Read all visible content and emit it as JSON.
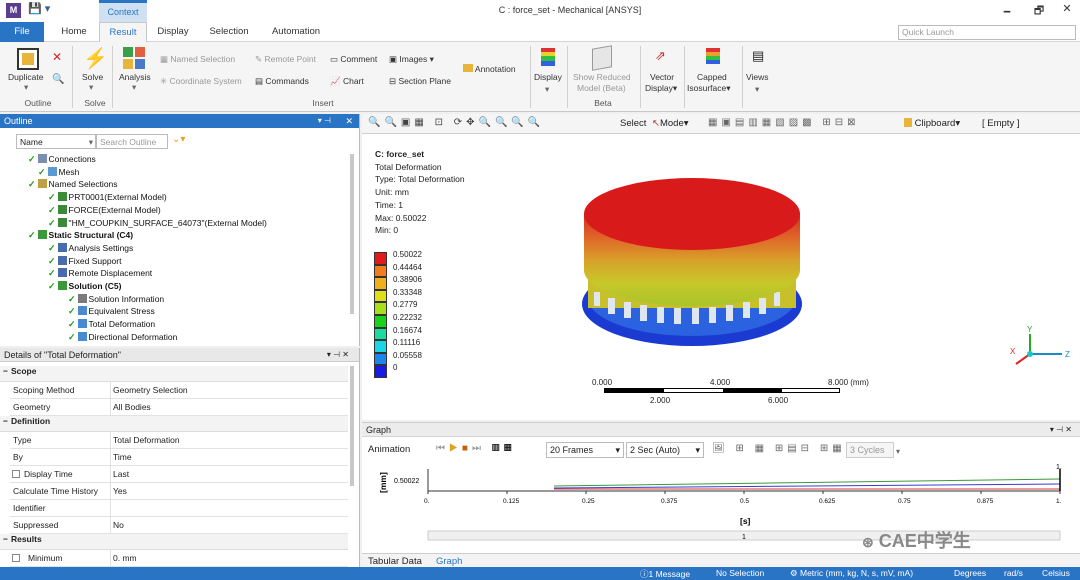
{
  "app": {
    "title": "C : force_set - Mechanical [ANSYS]",
    "icon_letter": "M",
    "quick_launch_placeholder": "Quick Launch",
    "context_tab": "Context",
    "win_minimize": "🗕",
    "win_restore": "🗗",
    "win_close": "✕",
    "colors": {
      "accent": "#2a74c6",
      "tree_check": "#1d9a1d"
    }
  },
  "tabs": [
    "File",
    "Home",
    "Result",
    "Display",
    "Selection",
    "Automation"
  ],
  "ribbon": {
    "duplicate": "Duplicate",
    "outline_group": "Outline",
    "solve": "Solve",
    "solve_group": "Solve",
    "analysis": "Analysis",
    "named_selection": "Named Selection",
    "coordinate_system": "Coordinate System",
    "remote_point": "Remote Point",
    "commands": "Commands",
    "comment": "Comment",
    "chart": "Chart",
    "images": "Images",
    "section_plane": "Section Plane",
    "annotation": "Annotation",
    "insert_group": "Insert",
    "display": "Display",
    "show_reduced_1": "Show Reduced",
    "show_reduced_2": "Model (Beta)",
    "beta_group": "Beta",
    "vector_1": "Vector",
    "vector_2": "Display",
    "capped_1": "Capped",
    "capped_2": "Isosurface",
    "views": "Views"
  },
  "outline": {
    "title": "Outline",
    "filter_value": "Name",
    "search_placeholder": "Search Outline",
    "pin": "📌",
    "pin_close": "✕",
    "tree": [
      {
        "label": "Connections",
        "indent": 0,
        "bold": false
      },
      {
        "label": "Mesh",
        "indent": 1,
        "bold": false
      },
      {
        "label": "Named Selections",
        "indent": 0,
        "bold": false
      },
      {
        "label": "PRT0001(External Model)",
        "indent": 2,
        "bold": false
      },
      {
        "label": "FORCE(External Model)",
        "indent": 2,
        "bold": false
      },
      {
        "label": "\"HM_COUPKIN_SURFACE_64073\"(External Model)",
        "indent": 2,
        "bold": false
      },
      {
        "label": "Static Structural (C4)",
        "indent": 0,
        "bold": true
      },
      {
        "label": "Analysis Settings",
        "indent": 2,
        "bold": false
      },
      {
        "label": "Fixed Support",
        "indent": 2,
        "bold": false
      },
      {
        "label": "Remote Displacement",
        "indent": 2,
        "bold": false
      },
      {
        "label": "Solution (C5)",
        "indent": 2,
        "bold": true
      },
      {
        "label": "Solution Information",
        "indent": 4,
        "bold": false
      },
      {
        "label": "Equivalent Stress",
        "indent": 4,
        "bold": false
      },
      {
        "label": "Total Deformation",
        "indent": 4,
        "bold": false
      },
      {
        "label": "Directional Deformation",
        "indent": 4,
        "bold": false
      }
    ]
  },
  "details": {
    "title": "Details of \"Total Deformation\"",
    "sections": {
      "scope": "Scope",
      "definition": "Definition",
      "results": "Results"
    },
    "rows": {
      "scoping_method": [
        "Scoping Method",
        "Geometry Selection"
      ],
      "geometry": [
        "Geometry",
        "All Bodies"
      ],
      "type": [
        "Type",
        "Total Deformation"
      ],
      "by": [
        "By",
        "Time"
      ],
      "display_time": [
        "Display Time",
        "Last"
      ],
      "calc_history": [
        "Calculate Time History",
        "Yes"
      ],
      "identifier": [
        "Identifier",
        ""
      ],
      "suppressed": [
        "Suppressed",
        "No"
      ],
      "minimum": [
        "Minimum",
        "0. mm"
      ]
    },
    "section_toggle": "−"
  },
  "viewport": {
    "toolbar": {
      "select": "Select",
      "mode": "Mode",
      "clipboard": "Clipboard",
      "empty": "[ Empty ]"
    },
    "info": {
      "name": "C: force_set",
      "line1": "Total Deformation",
      "line2": "Type: Total Deformation",
      "line3": "Unit: mm",
      "line4": "Time: 1",
      "line5": "Max: 0.50022",
      "line6": "Min: 0"
    },
    "legend": [
      {
        "value": "0.50022",
        "color": "#e31a1a"
      },
      {
        "value": "0.44464",
        "color": "#f47c1a"
      },
      {
        "value": "0.38906",
        "color": "#f0b01a"
      },
      {
        "value": "0.33348",
        "color": "#dede1a"
      },
      {
        "value": "0.2779",
        "color": "#a6e01a"
      },
      {
        "value": "0.22232",
        "color": "#1ad21a"
      },
      {
        "value": "0.16674",
        "color": "#1adca0"
      },
      {
        "value": "0.11116",
        "color": "#1ad6e6"
      },
      {
        "value": "0.05558",
        "color": "#1a86f0"
      },
      {
        "value": "0",
        "color": "#1a1ae6"
      }
    ],
    "scale": {
      "t0": "0.000",
      "t1": "4.000",
      "t2": "8.000 (mm)",
      "b1": "2.000",
      "b2": "6.000"
    },
    "triad": {
      "x": "X",
      "y": "Y",
      "z": "Z"
    }
  },
  "graph": {
    "title": "Graph",
    "animation": "Animation",
    "frames": "20 Frames",
    "speed": "2 Sec (Auto)",
    "cycles": "3 Cycles",
    "ylabel": "[mm]",
    "xlabel": "[s]",
    "ytick": "0.50022",
    "top_label": "1.",
    "xticks": [
      "0.",
      "0.125",
      "0.25",
      "0.375",
      "0.5",
      "0.625",
      "0.75",
      "0.875",
      "1."
    ],
    "slider_label": "1",
    "bottom_tabs": [
      "Tabular Data",
      "Graph"
    ],
    "watermark": "CAE中学生"
  },
  "status": {
    "messages": "1 Message",
    "selection": "No Selection",
    "units": "Metric (mm, kg, N, s, mV, mA)",
    "angle": "Degrees",
    "rate": "rad/s",
    "temp": "Celsius"
  }
}
